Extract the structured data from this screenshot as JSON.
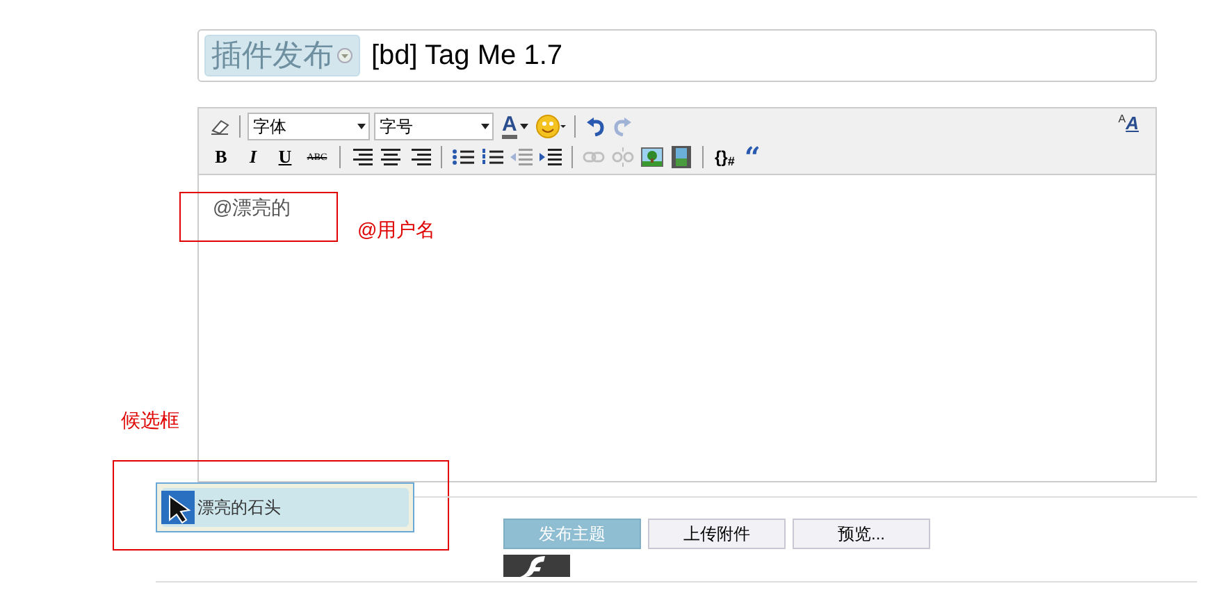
{
  "title_bar": {
    "category": "插件发布",
    "subject": "[bd] Tag Me 1.7"
  },
  "toolbar": {
    "font_select": "字体",
    "size_select": "字号",
    "font_color_label": "A",
    "undo": {
      "disabled": false
    },
    "redo": {
      "disabled": true
    },
    "text_size": {
      "small": "A",
      "large": "A"
    },
    "format_buttons": [
      {
        "label": "B"
      },
      {
        "label": "I"
      },
      {
        "label": "U"
      },
      {
        "label": "ABC"
      }
    ],
    "outdent": {
      "disabled": true
    },
    "link": {
      "disabled": true
    },
    "unlink": {
      "disabled": true
    },
    "code_label": "{}$_{#}$",
    "quote_label": "“"
  },
  "editor": {
    "content": "@漂亮的"
  },
  "annotations": [
    {
      "kind": "username",
      "label": "@用户名"
    },
    {
      "kind": "candidate",
      "label": "候选框"
    }
  ],
  "suggestion": {
    "name": "漂亮的石头",
    "selected": true
  },
  "buttons": [
    {
      "label": "发布主题",
      "selected": true
    },
    {
      "label": "上传附件",
      "selected": false
    },
    {
      "label": "预览...",
      "selected": false
    }
  ]
}
